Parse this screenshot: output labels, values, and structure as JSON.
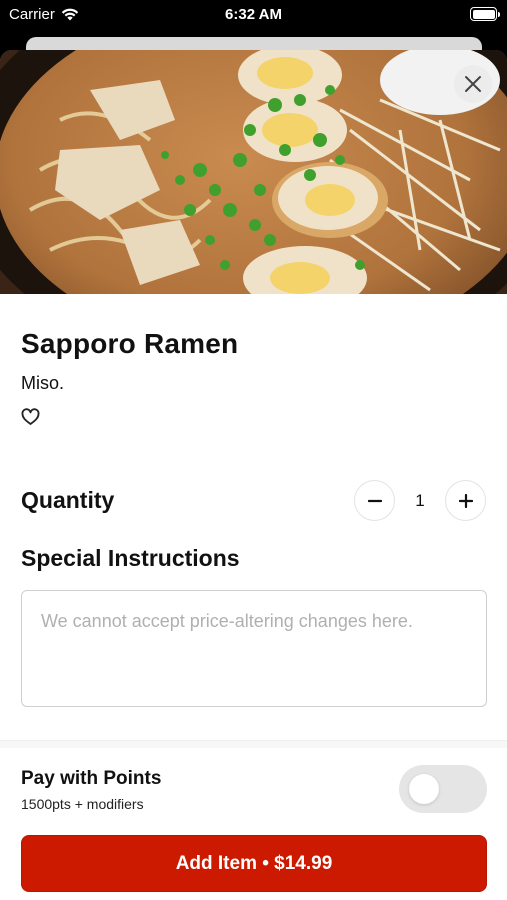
{
  "status_bar": {
    "carrier": "Carrier",
    "time": "6:32 AM"
  },
  "item": {
    "name": "Sapporo Ramen",
    "description": "Miso.",
    "image": "ramen-photo"
  },
  "quantity": {
    "label": "Quantity",
    "value": "1",
    "minus_icon": "minus-icon",
    "plus_icon": "plus-icon"
  },
  "instructions": {
    "label": "Special Instructions",
    "placeholder": "We cannot accept price-altering changes here.",
    "value": ""
  },
  "points": {
    "title": "Pay with Points",
    "subtitle": "1500pts + modifiers",
    "enabled": false
  },
  "cta": {
    "label": "Add Item • $14.99"
  },
  "colors": {
    "accent": "#cc1a00",
    "toggle_off": "#e5e5e5"
  }
}
